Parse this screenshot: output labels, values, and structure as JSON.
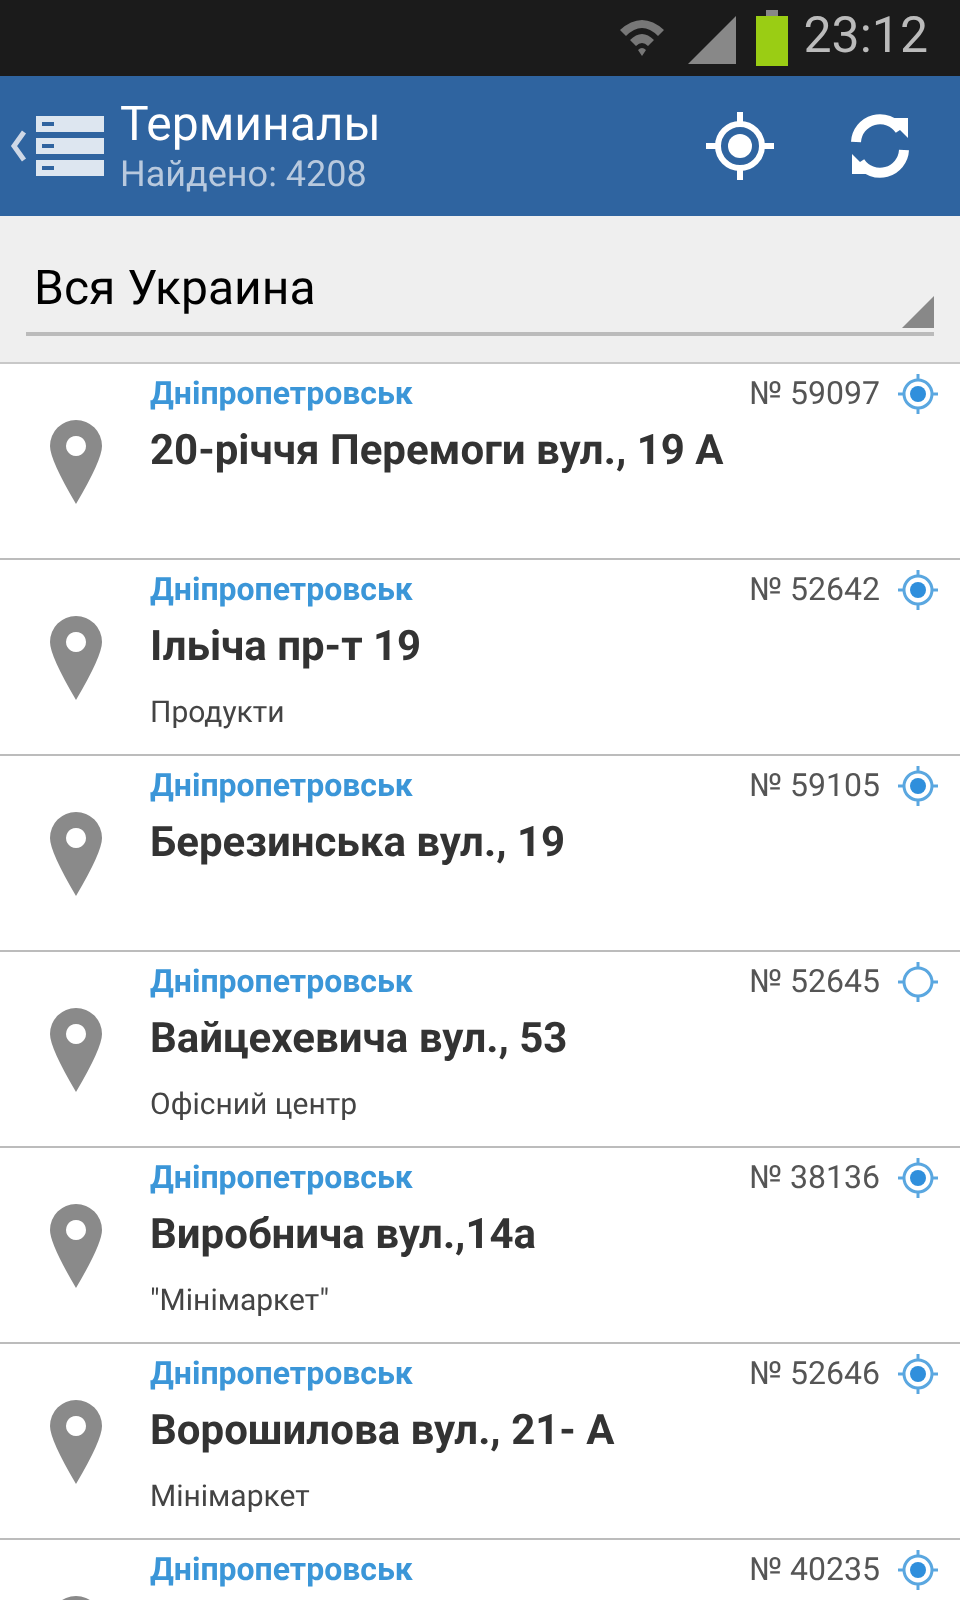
{
  "status_bar": {
    "time": "23:12"
  },
  "header": {
    "title": "Терминалы",
    "subtitle": "Найдено: 4208"
  },
  "region_select": {
    "value": "Вся Украина"
  },
  "terminals": [
    {
      "city": "Дніпропетровськ",
      "number": "№ 59097",
      "address": "20-річчя Перемоги вул., 19 А",
      "located": true
    },
    {
      "city": "Дніпропетровськ",
      "number": "№ 52642",
      "address": "Ільіча пр-т 19",
      "note": "Продукти",
      "located": true
    },
    {
      "city": "Дніпропетровськ",
      "number": "№ 59105",
      "address": "Березинська вул., 19",
      "located": true
    },
    {
      "city": "Дніпропетровськ",
      "number": "№ 52645",
      "address": "Вайцехевича вул., 53",
      "note": "Офісний центр",
      "located": false
    },
    {
      "city": "Дніпропетровськ",
      "number": "№ 38136",
      "address": "Виробнича вул.,14а",
      "note": "\"Мінімаркет\"",
      "located": true
    },
    {
      "city": "Дніпропетровськ",
      "number": "№ 52646",
      "address": "Ворошилова вул., 21- А",
      "note": "Мінімаркет",
      "located": true
    },
    {
      "city": "Дніпропетровськ",
      "number": "№ 40235",
      "located": true
    }
  ]
}
